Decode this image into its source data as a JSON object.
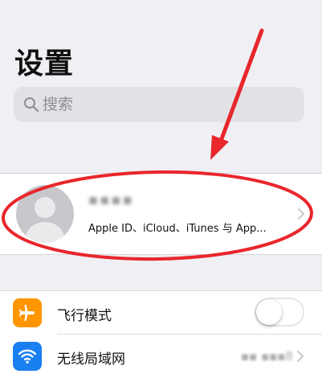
{
  "header": {
    "title": "设置"
  },
  "search": {
    "placeholder": "搜索"
  },
  "account": {
    "name": "▪▪▪▪",
    "subtitle": "Apple ID、iCloud、iTunes 与 App..."
  },
  "settings": [
    {
      "label": "飞行模式",
      "icon": "airplane-icon",
      "icon_color": "#ff9500",
      "toggle_on": false
    },
    {
      "label": "无线局域网",
      "icon": "wifi-icon",
      "icon_color": "#1a7ff0",
      "value": "▪▪ ▪▪▪8"
    }
  ],
  "colors": {
    "annotation": "#e8262b",
    "background": "#efeff4"
  }
}
